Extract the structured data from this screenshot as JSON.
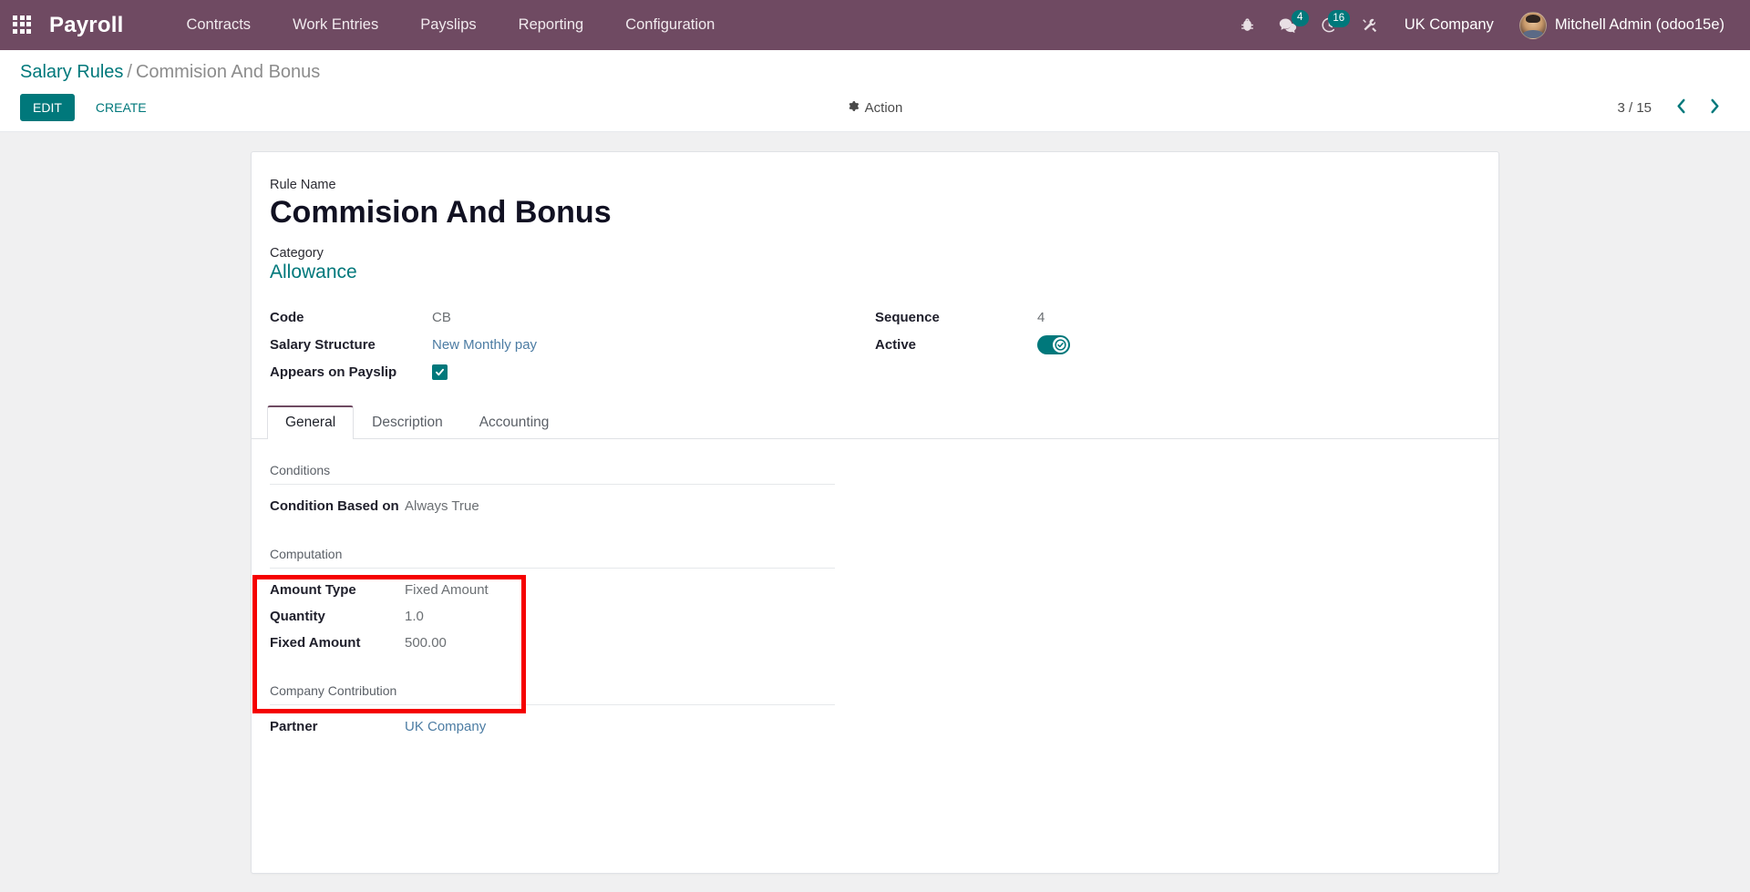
{
  "navbar": {
    "apps_icon": "apps-grid-icon",
    "brand": "Payroll",
    "menu": [
      {
        "label": "Contracts"
      },
      {
        "label": "Work Entries"
      },
      {
        "label": "Payslips"
      },
      {
        "label": "Reporting"
      },
      {
        "label": "Configuration"
      }
    ],
    "icons": {
      "bug": "bug-icon",
      "messages": "messages-icon",
      "activities": "activities-clock-icon",
      "tools": "tools-icon"
    },
    "messages_count": "4",
    "activities_count": "16",
    "company": "UK Company",
    "user": "Mitchell Admin (odoo15e)"
  },
  "control_panel": {
    "breadcrumb_root": "Salary Rules",
    "breadcrumb_sep": "/",
    "breadcrumb_current": "Commision And Bonus",
    "edit_label": "EDIT",
    "create_label": "CREATE",
    "action_label": "Action",
    "pager_text": "3 / 15",
    "prev_label": "previous-record",
    "next_label": "next-record"
  },
  "form": {
    "rule_name_label": "Rule Name",
    "rule_name_value": "Commision And Bonus",
    "category_label": "Category",
    "category_value": "Allowance",
    "fields_left": [
      {
        "label": "Code",
        "value": "CB",
        "type": "text"
      },
      {
        "label": "Salary Structure",
        "value": "New Monthly pay",
        "type": "link"
      },
      {
        "label": "Appears on Payslip",
        "value": "",
        "type": "checkbox"
      }
    ],
    "fields_right": [
      {
        "label": "Sequence",
        "value": "4",
        "type": "text"
      },
      {
        "label": "Active",
        "value": "",
        "type": "toggle"
      }
    ],
    "tabs": [
      {
        "label": "General",
        "active": true
      },
      {
        "label": "Description",
        "active": false
      },
      {
        "label": "Accounting",
        "active": false
      }
    ],
    "groups": [
      {
        "title": "Conditions",
        "rows": [
          {
            "label": "Condition Based on",
            "value": "Always True"
          }
        ]
      },
      {
        "title": "Computation",
        "rows": [
          {
            "label": "Amount Type",
            "value": "Fixed Amount"
          },
          {
            "label": "Quantity",
            "value": "1.0"
          },
          {
            "label": "Fixed Amount",
            "value": "500.00"
          }
        ]
      },
      {
        "title": "Company Contribution",
        "rows": [
          {
            "label": "Partner",
            "value": "UK Company",
            "type": "link"
          }
        ]
      }
    ]
  },
  "annotation": {
    "type": "red-highlight-box",
    "target": "computation-group"
  },
  "colors": {
    "navbar": "#6f4a62",
    "accent_teal": "#00787b",
    "badge": "#00787b",
    "annotation_red": "#f50000",
    "page_bg": "#f0f0f1",
    "link_blue": "#4c7ca3"
  }
}
